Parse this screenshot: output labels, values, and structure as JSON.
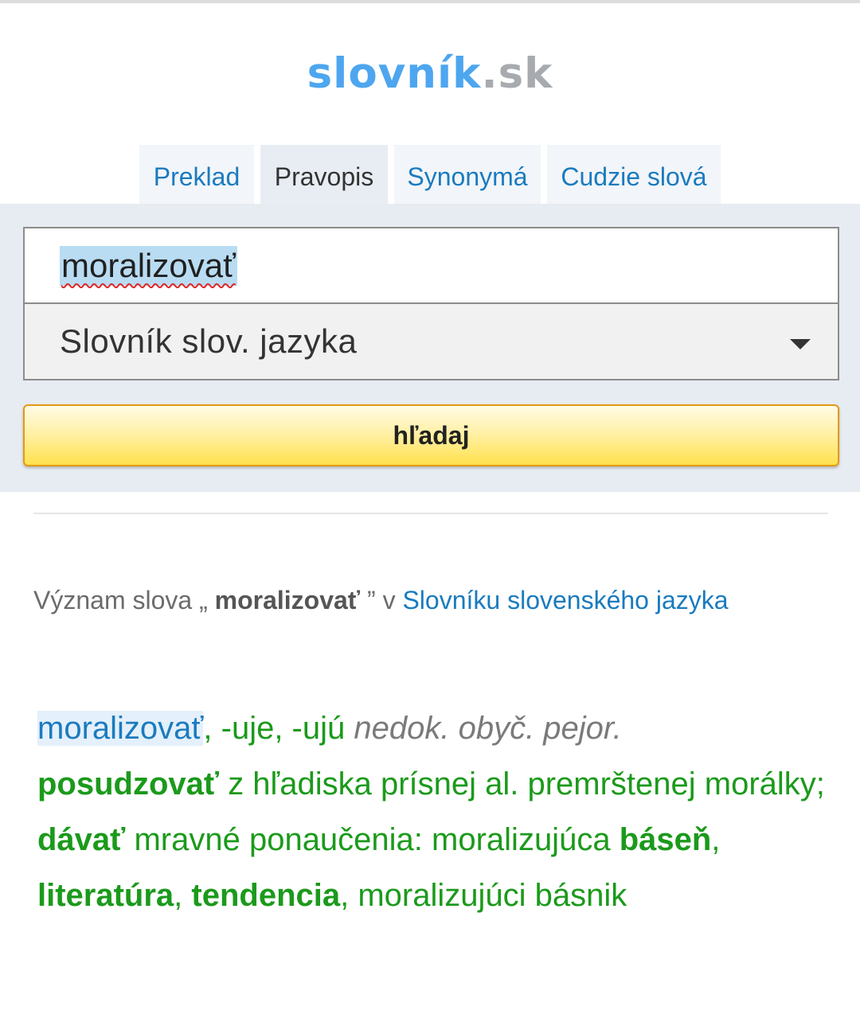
{
  "logo": {
    "main": "slovník",
    "tld": ".sk"
  },
  "tabs": [
    {
      "label": "Preklad",
      "active": false
    },
    {
      "label": "Pravopis",
      "active": true
    },
    {
      "label": "Synonymá",
      "active": false
    },
    {
      "label": "Cudzie slová",
      "active": false
    }
  ],
  "search": {
    "query": "moralizovať",
    "dictionary_selected": "Slovník slov. jazyka",
    "button_label": "hľadaj"
  },
  "result": {
    "prefix": "Význam slova „ ",
    "word": "moralizovať",
    "middle": " ” v ",
    "source_link": "Slovníku slovenského jazyka"
  },
  "entry": {
    "headword": "moralizovať",
    "forms": ", -uje, -ujú ",
    "grammar": "nedok. obyč. pejor.",
    "sense1_bold": "posudzovať",
    "sense1_rest": " z hľadiska prísnej al. premrštenej morálky;",
    "sense2_bold": "dávať",
    "sense2_rest": " mravné ponaučenia: moralizujúca ",
    "coll1": "báseň",
    "sep1": ", ",
    "coll2": "literatúra",
    "sep2": ", ",
    "coll3": "tendencia",
    "tail": ", moralizujúci básnik"
  },
  "colors": {
    "logo_blue": "#4da6ef",
    "logo_gray": "#a7abaf",
    "link_blue": "#1a7bbf",
    "definition_green": "#1b9a1b",
    "button_yellow": "#ffe14d",
    "panel_bg": "#e7ecf2"
  },
  "icons": {
    "select_arrow": "chevron-down-icon"
  }
}
